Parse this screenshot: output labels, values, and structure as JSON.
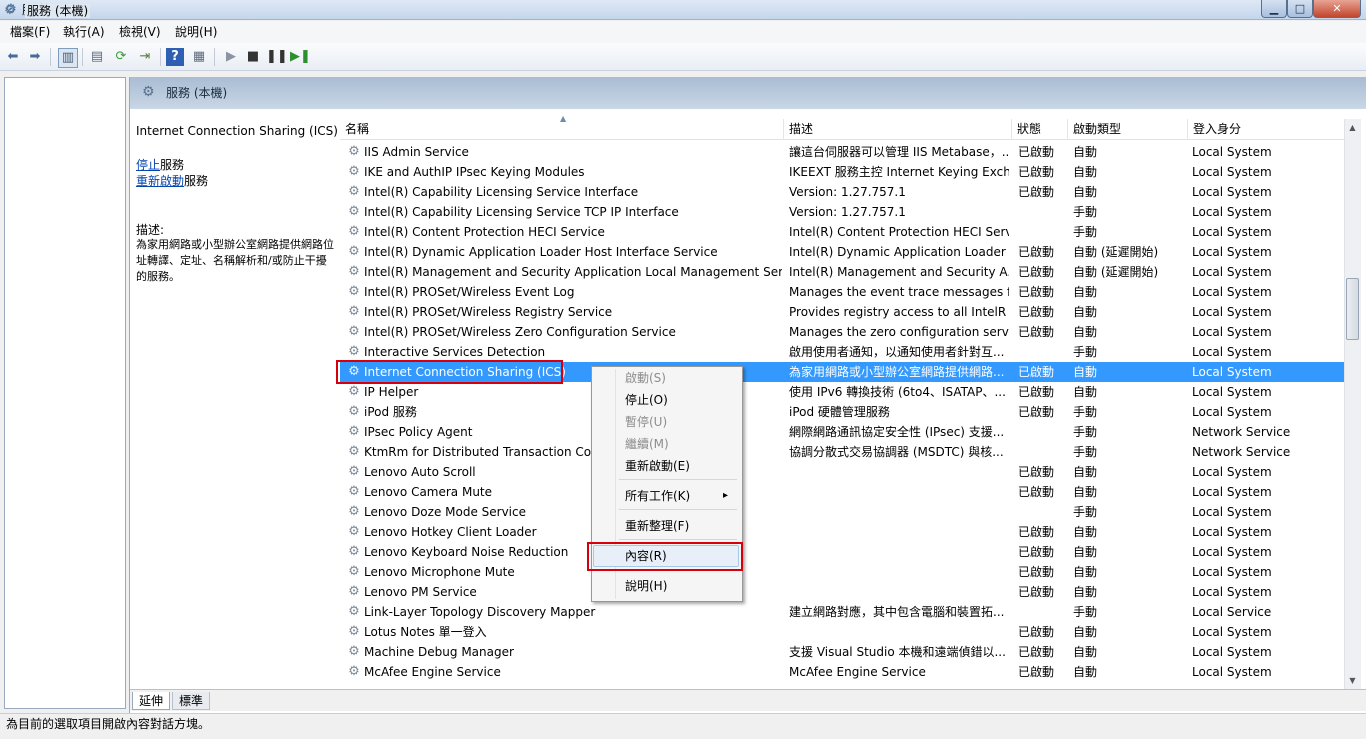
{
  "window": {
    "title": "服務"
  },
  "menu": [
    "檔案(F)",
    "執行(A)",
    "檢視(V)",
    "說明(H)"
  ],
  "tree": {
    "root_label": "服務 (本機)"
  },
  "pane_header": {
    "title": "服務 (本機)"
  },
  "detail": {
    "service_title": "Internet Connection Sharing (ICS)",
    "stop_link": "停止",
    "stop_suffix": "服務",
    "restart_link": "重新啟動",
    "restart_suffix": "服務",
    "description_label": "描述:",
    "description_text": "為家用網路或小型辦公室網路提供網路位址轉譯、定址、名稱解析和/或防止干擾的服務。"
  },
  "columns": [
    "名稱",
    "描述",
    "狀態",
    "啟動類型",
    "登入身分"
  ],
  "rows": [
    {
      "name": "IIS Admin Service",
      "desc": "讓這台伺服器可以管理 IIS Metabase，...",
      "state": "已啟動",
      "start": "自動",
      "logon": "Local System"
    },
    {
      "name": "IKE and AuthIP IPsec Keying Modules",
      "desc": "IKEEXT 服務主控 Internet Keying Exch...",
      "state": "已啟動",
      "start": "自動",
      "logon": "Local System"
    },
    {
      "name": "Intel(R) Capability Licensing Service Interface",
      "desc": "Version: 1.27.757.1",
      "state": "已啟動",
      "start": "自動",
      "logon": "Local System"
    },
    {
      "name": "Intel(R) Capability Licensing Service TCP IP Interface",
      "desc": "Version: 1.27.757.1",
      "state": "",
      "start": "手動",
      "logon": "Local System"
    },
    {
      "name": "Intel(R) Content Protection HECI Service",
      "desc": "Intel(R) Content Protection HECI Serv...",
      "state": "",
      "start": "手動",
      "logon": "Local System"
    },
    {
      "name": "Intel(R) Dynamic Application Loader Host Interface Service",
      "desc": "Intel(R) Dynamic Application Loader ...",
      "state": "已啟動",
      "start": "自動 (延遲開始)",
      "logon": "Local System"
    },
    {
      "name": "Intel(R) Management and Security Application Local Management Service",
      "desc": "Intel(R) Management and Security A...",
      "state": "已啟動",
      "start": "自動 (延遲開始)",
      "logon": "Local System"
    },
    {
      "name": "Intel(R) PROSet/Wireless Event Log",
      "desc": "Manages the event trace messages f...",
      "state": "已啟動",
      "start": "自動",
      "logon": "Local System"
    },
    {
      "name": "Intel(R) PROSet/Wireless Registry Service",
      "desc": "Provides registry access to all IntelR P...",
      "state": "已啟動",
      "start": "自動",
      "logon": "Local System"
    },
    {
      "name": "Intel(R) PROSet/Wireless Zero Configuration Service",
      "desc": "Manages the zero configuration serv...",
      "state": "已啟動",
      "start": "自動",
      "logon": "Local System"
    },
    {
      "name": "Interactive Services Detection",
      "desc": "啟用使用者通知，以通知使用者針對互...",
      "state": "",
      "start": "手動",
      "logon": "Local System"
    },
    {
      "name": "Internet Connection Sharing (ICS)",
      "desc": "為家用網路或小型辦公室網路提供網路...",
      "state": "已啟動",
      "start": "自動",
      "logon": "Local System",
      "selected": true
    },
    {
      "name": "IP Helper",
      "desc": "使用 IPv6 轉換技術 (6to4、ISATAP、...",
      "state": "已啟動",
      "start": "自動",
      "logon": "Local System"
    },
    {
      "name": "iPod 服務",
      "desc": "iPod 硬體管理服務",
      "state": "已啟動",
      "start": "手動",
      "logon": "Local System"
    },
    {
      "name": "IPsec Policy Agent",
      "desc": "網際網路通訊協定安全性 (IPsec) 支援...",
      "state": "",
      "start": "手動",
      "logon": "Network Service"
    },
    {
      "name": "KtmRm for Distributed Transaction Coordinator",
      "desc": "協調分散式交易協調器 (MSDTC) 與核...",
      "state": "",
      "start": "手動",
      "logon": "Network Service"
    },
    {
      "name": "Lenovo Auto Scroll",
      "desc": "",
      "state": "已啟動",
      "start": "自動",
      "logon": "Local System"
    },
    {
      "name": "Lenovo Camera Mute",
      "desc": "",
      "state": "已啟動",
      "start": "自動",
      "logon": "Local System"
    },
    {
      "name": "Lenovo Doze Mode Service",
      "desc": "",
      "state": "",
      "start": "手動",
      "logon": "Local System"
    },
    {
      "name": "Lenovo Hotkey Client Loader",
      "desc": "",
      "state": "已啟動",
      "start": "自動",
      "logon": "Local System"
    },
    {
      "name": "Lenovo Keyboard Noise Reduction",
      "desc": "",
      "state": "已啟動",
      "start": "自動",
      "logon": "Local System"
    },
    {
      "name": "Lenovo Microphone Mute",
      "desc": "",
      "state": "已啟動",
      "start": "自動",
      "logon": "Local System"
    },
    {
      "name": "Lenovo PM Service",
      "desc": "",
      "state": "已啟動",
      "start": "自動",
      "logon": "Local System"
    },
    {
      "name": "Link-Layer Topology Discovery Mapper",
      "desc": "建立網路對應，其中包含電腦和裝置拓...",
      "state": "",
      "start": "手動",
      "logon": "Local Service"
    },
    {
      "name": "Lotus Notes 單一登入",
      "desc": "",
      "state": "已啟動",
      "start": "自動",
      "logon": "Local System"
    },
    {
      "name": "Machine Debug Manager",
      "desc": "支援 Visual Studio 本機和遠端偵錯以...",
      "state": "已啟動",
      "start": "自動",
      "logon": "Local System"
    },
    {
      "name": "McAfee Engine Service",
      "desc": "McAfee Engine Service",
      "state": "已啟動",
      "start": "自動",
      "logon": "Local System"
    }
  ],
  "context_menu": [
    {
      "label": "啟動(S)",
      "disabled": true
    },
    {
      "label": "停止(O)",
      "disabled": false
    },
    {
      "label": "暫停(U)",
      "disabled": true
    },
    {
      "label": "繼續(M)",
      "disabled": true
    },
    {
      "label": "重新啟動(E)",
      "disabled": false
    },
    {
      "label": "所有工作(K)",
      "disabled": false,
      "submenu": true
    },
    {
      "label": "重新整理(F)",
      "disabled": false
    },
    {
      "label": "內容(R)",
      "disabled": false,
      "highlighted": true
    },
    {
      "label": "說明(H)",
      "disabled": false
    }
  ],
  "tabs": [
    "延伸",
    "標準"
  ],
  "status": {
    "text": "為目前的選取項目開啟內容對話方塊。"
  },
  "icons": {
    "service": "gear-icon",
    "app": "services-icon"
  }
}
